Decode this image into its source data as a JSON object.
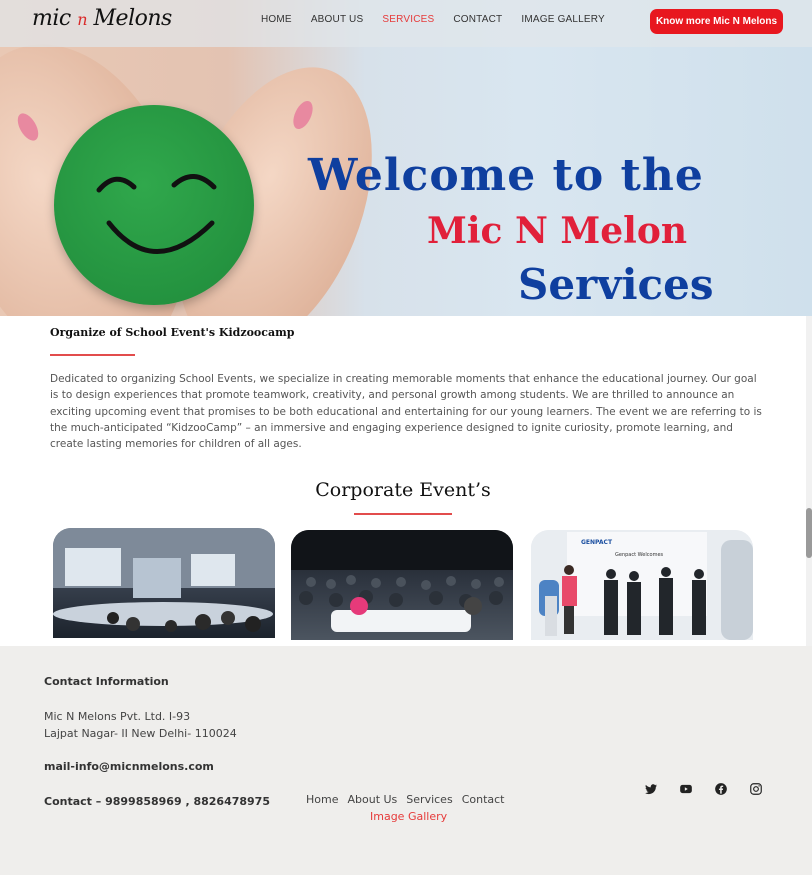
{
  "brand": {
    "logo_text": "mic",
    "logo_n": "n",
    "logo_rest": "Melons"
  },
  "nav": {
    "items": [
      "HOME",
      "ABOUT US",
      "SERVICES",
      "CONTACT",
      "IMAGE GALLERY"
    ],
    "active": "SERVICES",
    "cta_label": "Know more Mic N Melons"
  },
  "hero": {
    "line1": "Welcome to the",
    "line2": "Mic N Melon",
    "line3": "Services"
  },
  "section": {
    "title": "Organize of School Event's Kidzoocamp",
    "body": "Dedicated to organizing School Events, we specialize in creating memorable moments that enhance the educational journey. Our goal is to design experiences that promote teamwork, creativity, and personal growth among students. We are thrilled to announce an exciting upcoming event that promises to be both educational and entertaining for our young learners. The event we are referring to is the much-anticipated “KidzooCamp” – an immersive and engaging experience designed to ignite curiosity, promote learning, and create lasting memories for children of all ages."
  },
  "corporate": {
    "title": "Corporate Event’s",
    "event3_banner": "Genpact Welcomes",
    "event3_logo": "GENPACT"
  },
  "footer": {
    "heading": "Contact Information",
    "address_line1": "Mic N Melons Pvt. Ltd. I-93",
    "address_line2": "Lajpat Nagar- II New Delhi- 110024",
    "email": "mail-info@micnmelons.com",
    "phone": "Contact – 9899858969 , 8826478975",
    "links": [
      "Home",
      "About Us",
      "Services",
      "Contact"
    ],
    "gallery_link": "Image Gallery",
    "socials": [
      "twitter-icon",
      "youtube-icon",
      "facebook-icon",
      "instagram-icon"
    ]
  },
  "colors": {
    "accent_red": "#e8171f",
    "hero_blue": "#0f3f9f",
    "hero_red": "#e1203a",
    "footer_bg": "#efeeec"
  }
}
